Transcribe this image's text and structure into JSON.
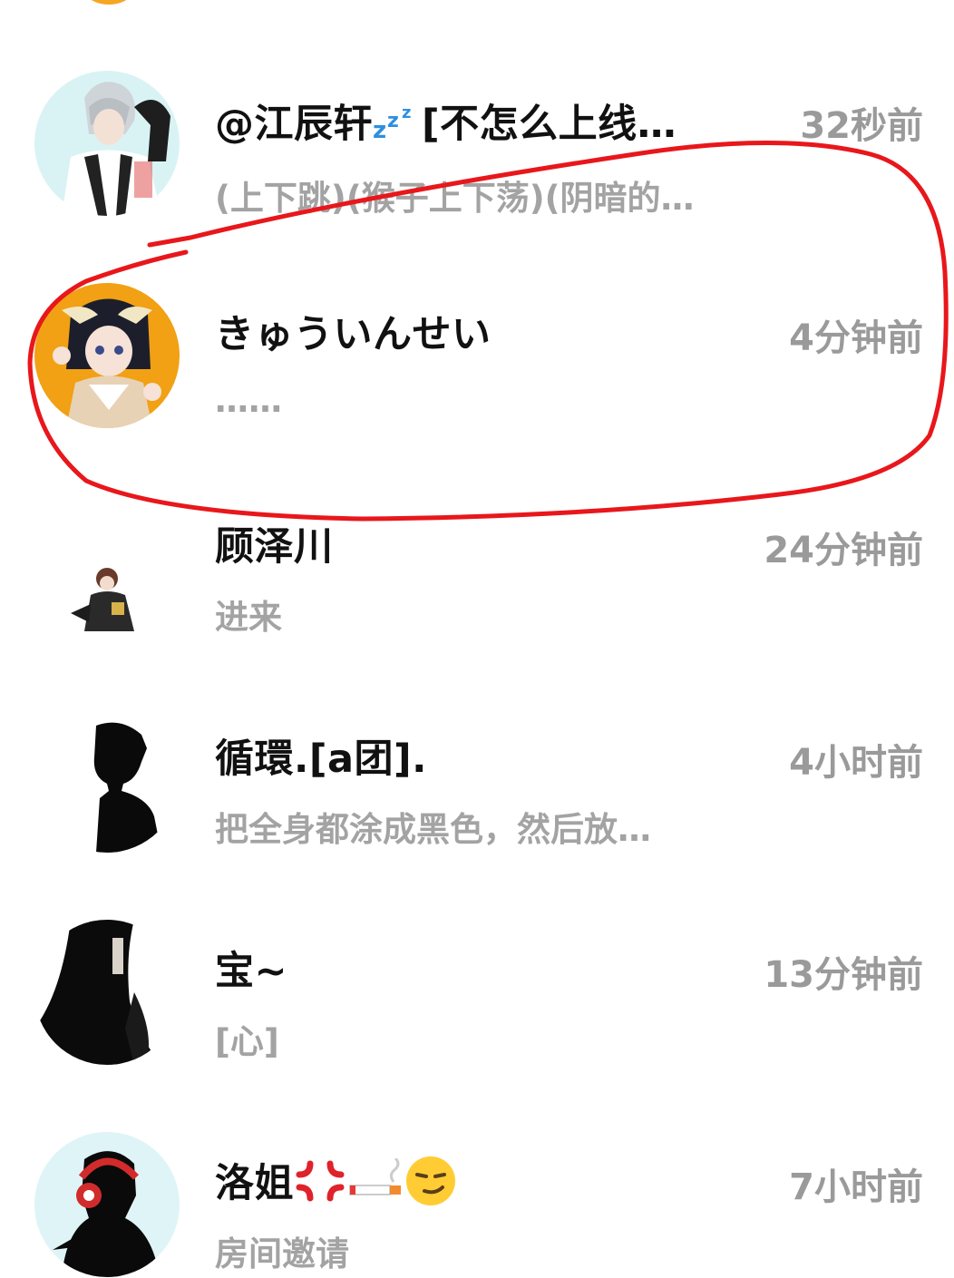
{
  "colors": {
    "name_text": "#111111",
    "secondary_text": "#a3a3a3",
    "time_text": "#9a9a9a",
    "annotation_red": "#e8171b"
  },
  "chats": [
    {
      "name": "@江辰轩",
      "name_suffix": "[不怎么上线…",
      "name_emoji": "zzz-icon",
      "time": "32秒前",
      "preview": "(上下跳)(猴子上下荡)(阴暗的…",
      "avatar": "white-haired-character-avatar"
    },
    {
      "name": "きゅういんせい",
      "time": "4分钟前",
      "preview": "……",
      "avatar": "orange-background-anime-girl-avatar"
    },
    {
      "name": "顾泽川",
      "time": "24分钟前",
      "preview": "进来",
      "avatar": "small-character-avatar"
    },
    {
      "name": "循環.[a团].",
      "time": "4小时前",
      "preview": "把全身都涂成黑色，然后放…",
      "avatar": "black-silhouette-avatar"
    },
    {
      "name": "宝~",
      "time": "13分钟前",
      "preview": "[心]",
      "avatar": "dark-figure-avatar"
    },
    {
      "name": "洛姐",
      "name_emojis": [
        "anger-icon",
        "cigarette-icon",
        "smirk-face-icon"
      ],
      "time": "7小时前",
      "preview": "房间邀请",
      "avatar": "headphones-silhouette-avatar"
    }
  ]
}
